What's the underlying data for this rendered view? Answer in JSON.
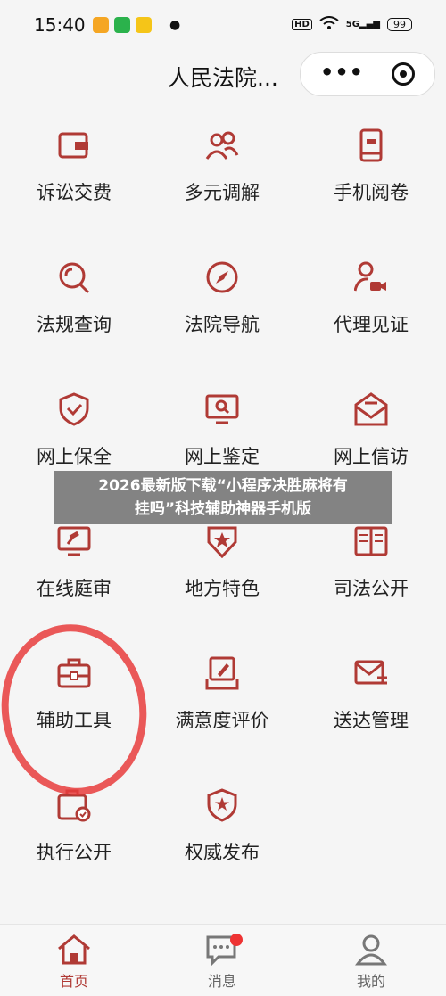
{
  "status": {
    "time": "15:40",
    "hd": "HD",
    "signal": "5G",
    "battery": "99"
  },
  "header": {
    "title": "人民法院..."
  },
  "grid": [
    {
      "label": "诉讼交费"
    },
    {
      "label": "多元调解"
    },
    {
      "label": "手机阅卷"
    },
    {
      "label": "法规查询"
    },
    {
      "label": "法院导航"
    },
    {
      "label": "代理见证"
    },
    {
      "label": "网上保全"
    },
    {
      "label": "网上鉴定"
    },
    {
      "label": "网上信访"
    },
    {
      "label": "在线庭审"
    },
    {
      "label": "地方特色"
    },
    {
      "label": "司法公开"
    },
    {
      "label": "辅助工具"
    },
    {
      "label": "满意度评价"
    },
    {
      "label": "送达管理"
    },
    {
      "label": "执行公开"
    },
    {
      "label": "权威发布"
    }
  ],
  "banner": {
    "line1": "2026最新版下载“小程序决胜麻将有",
    "line2": "挂吗”科技辅助神器手机版"
  },
  "tabs": [
    {
      "label": "首页"
    },
    {
      "label": "消息"
    },
    {
      "label": "我的"
    }
  ],
  "colors": {
    "accent": "#b03a35",
    "annotation_circle": "#e73c3c"
  }
}
